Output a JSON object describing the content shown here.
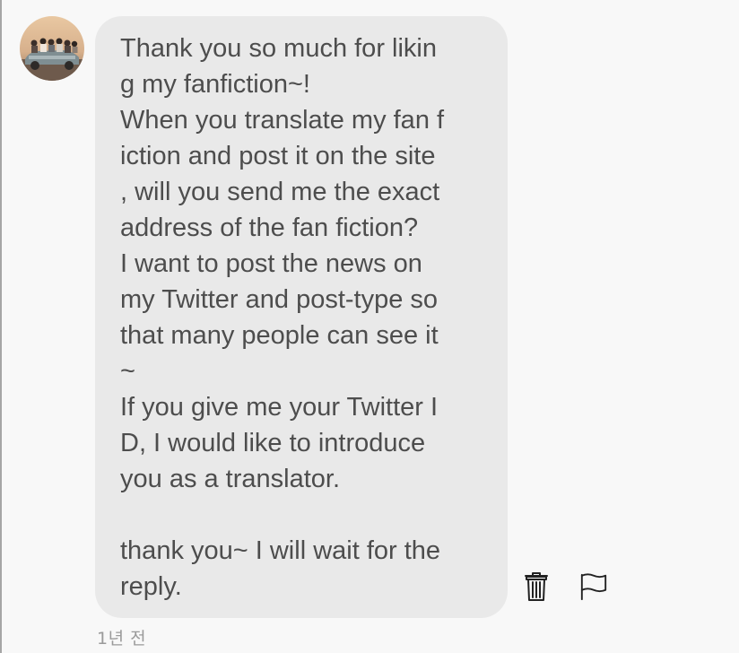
{
  "message": {
    "text": "Thank you so much for likin\ng my fanfiction~!\nWhen you translate my fan f\niction and post it on the site\n, will you send me the exact\naddress of the fan fiction?\nI want to post the news on\nmy Twitter and post-type so\nthat many people can see it\n~\nIf you give me your Twitter I\nD, I would like to introduce\nyou as a translator.\n\nthank you~ I will wait for the\nreply.",
    "timestamp": "1년 전"
  },
  "actions": {
    "delete_icon": "trash-icon",
    "report_icon": "flag-icon"
  },
  "colors": {
    "background": "#f8f8f8",
    "bubble": "#e9e9e9",
    "text": "#4d4d4d",
    "timestamp": "#9a9a9a",
    "icon": "#222222"
  }
}
